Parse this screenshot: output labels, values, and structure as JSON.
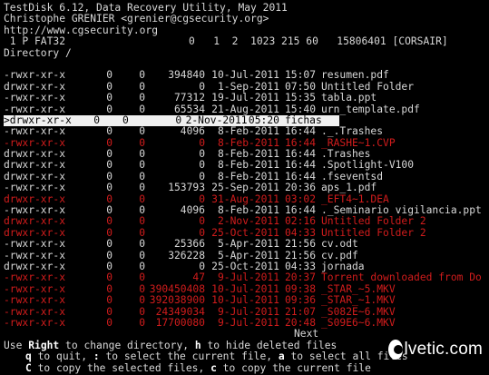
{
  "header": {
    "line1": "TestDisk 6.12, Data Recovery Utility, May 2011",
    "line2": "Christophe GRENIER <grenier@cgsecurity.org>",
    "line3": "http://www.cgsecurity.org",
    "line4": " 1 P FAT32                    0   1  2  1023 215 60   15806401 [CORSAIR]",
    "line5": "Directory /"
  },
  "files": [
    {
      "perm": "-rwxr-xr-x",
      "uid": "0",
      "gid": "0",
      "size": "394840",
      "date": "10-Jul-2011",
      "time": "15:07",
      "name": "resumen.pdf",
      "state": "normal"
    },
    {
      "perm": "drwxr-xr-x",
      "uid": "0",
      "gid": "0",
      "size": "0",
      "date": "1-Sep-2011",
      "time": "07:50",
      "name": "Untitled Folder",
      "state": "normal"
    },
    {
      "perm": "-rwxr-xr-x",
      "uid": "0",
      "gid": "0",
      "size": "77312",
      "date": "19-Jul-2011",
      "time": "15:35",
      "name": "tabla.ppt",
      "state": "normal"
    },
    {
      "perm": "-rwxr-xr-x",
      "uid": "0",
      "gid": "0",
      "size": "65534",
      "date": "21-Aug-2011",
      "time": "15:40",
      "name": "urn_template.pdf",
      "state": "normal"
    },
    {
      "perm": ">drwxr-xr-x",
      "uid": "0",
      "gid": "0",
      "size": "0",
      "date": "2-Nov-2011",
      "time": "05:20",
      "name": "fichas",
      "state": "selected"
    },
    {
      "perm": "-rwxr-xr-x",
      "uid": "0",
      "gid": "0",
      "size": "4096",
      "date": "8-Feb-2011",
      "time": "16:44",
      "name": "._.Trashes",
      "state": "normal"
    },
    {
      "perm": "-rwxr-xr-x",
      "uid": "0",
      "gid": "0",
      "size": "0",
      "date": "8-Feb-2011",
      "time": "16:44",
      "name": "_RASHE~1.CVP",
      "state": "deleted"
    },
    {
      "perm": "drwxr-xr-x",
      "uid": "0",
      "gid": "0",
      "size": "0",
      "date": "8-Feb-2011",
      "time": "16:44",
      "name": ".Trashes",
      "state": "normal"
    },
    {
      "perm": "drwxr-xr-x",
      "uid": "0",
      "gid": "0",
      "size": "0",
      "date": "8-Feb-2011",
      "time": "16:44",
      "name": ".Spotlight-V100",
      "state": "normal"
    },
    {
      "perm": "drwxr-xr-x",
      "uid": "0",
      "gid": "0",
      "size": "0",
      "date": "8-Feb-2011",
      "time": "16:44",
      "name": ".fseventsd",
      "state": "normal"
    },
    {
      "perm": "-rwxr-xr-x",
      "uid": "0",
      "gid": "0",
      "size": "153793",
      "date": "25-Sep-2011",
      "time": "20:36",
      "name": "aps_1.pdf",
      "state": "normal"
    },
    {
      "perm": "drwxr-xr-x",
      "uid": "0",
      "gid": "0",
      "size": "0",
      "date": "31-Aug-2011",
      "time": "03:02",
      "name": "_EFT4~1.DEA",
      "state": "deleted"
    },
    {
      "perm": "-rwxr-xr-x",
      "uid": "0",
      "gid": "0",
      "size": "4096",
      "date": "8-Feb-2011",
      "time": "16:44",
      "name": "._Seminario vigilancia.ppt",
      "state": "normal"
    },
    {
      "perm": "drwxr-xr-x",
      "uid": "0",
      "gid": "0",
      "size": "0",
      "date": "2-Nov-2011",
      "time": "02:16",
      "name": "Untitled Folder 2",
      "state": "deleted"
    },
    {
      "perm": "drwxr-xr-x",
      "uid": "0",
      "gid": "0",
      "size": "0",
      "date": "25-Oct-2011",
      "time": "04:33",
      "name": "Untitled Folder 2",
      "state": "deleted"
    },
    {
      "perm": "-rwxr-xr-x",
      "uid": "0",
      "gid": "0",
      "size": "25366",
      "date": "5-Apr-2011",
      "time": "21:56",
      "name": "cv.odt",
      "state": "normal"
    },
    {
      "perm": "-rwxr-xr-x",
      "uid": "0",
      "gid": "0",
      "size": "326228",
      "date": "5-Apr-2011",
      "time": "21:56",
      "name": "cv.pdf",
      "state": "normal"
    },
    {
      "perm": "drwxr-xr-x",
      "uid": "0",
      "gid": "0",
      "size": "0",
      "date": "25-Oct-2011",
      "time": "04:33",
      "name": "jornada",
      "state": "normal"
    },
    {
      "perm": "-rwxr-xr-x",
      "uid": "0",
      "gid": "0",
      "size": "47",
      "date": "9-Jul-2011",
      "time": "20:37",
      "name": "Torrent downloaded from Do",
      "state": "deleted"
    },
    {
      "perm": "-rwxr-xr-x",
      "uid": "0",
      "gid": "0",
      "size": "390450408",
      "date": "10-Jul-2011",
      "time": "09:38",
      "name": "_STAR_~5.MKV",
      "state": "deleted"
    },
    {
      "perm": "-rwxr-xr-x",
      "uid": "0",
      "gid": "0",
      "size": "392038900",
      "date": "10-Jul-2011",
      "time": "09:36",
      "name": "_STAR_~1.MKV",
      "state": "deleted"
    },
    {
      "perm": "-rwxr-xr-x",
      "uid": "0",
      "gid": "0",
      "size": "24349034",
      "date": "9-Jul-2011",
      "time": "21:07",
      "name": "_S082E~6.MKV",
      "state": "deleted"
    },
    {
      "perm": "-rwxr-xr-x",
      "uid": "0",
      "gid": "0",
      "size": "17700080",
      "date": "9-Jul-2011",
      "time": "20:48",
      "name": "_S09E6~6.MKV",
      "state": "deleted"
    }
  ],
  "next_label": "Next",
  "help": {
    "line1": [
      {
        "text": "Use ",
        "bold": false
      },
      {
        "text": "Right",
        "bold": true
      },
      {
        "text": " to change directory, ",
        "bold": false
      },
      {
        "text": "h",
        "bold": true
      },
      {
        "text": " to hide deleted files",
        "bold": false
      }
    ],
    "line2": [
      {
        "text": "q",
        "bold": true
      },
      {
        "text": " to quit, ",
        "bold": false
      },
      {
        "text": ":",
        "bold": true
      },
      {
        "text": " to select the current file, ",
        "bold": false
      },
      {
        "text": "a",
        "bold": true
      },
      {
        "text": " to select all files",
        "bold": false
      }
    ],
    "line3": [
      {
        "text": "C",
        "bold": true
      },
      {
        "text": " to copy the selected files, ",
        "bold": false
      },
      {
        "text": "c",
        "bold": true
      },
      {
        "text": " to copy the current file",
        "bold": false
      }
    ]
  },
  "watermark": {
    "text": "lvetic",
    "suffix": ".com",
    "icon": "solvetic-s-icon"
  },
  "colors": {
    "background": "#000000",
    "text": "#d8d8d8",
    "deleted": "#d11c1c",
    "selected_bg": "#f0f0f0"
  }
}
